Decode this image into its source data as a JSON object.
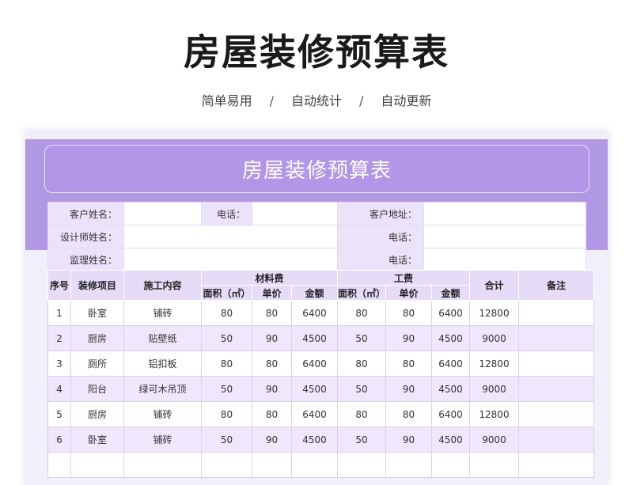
{
  "page": {
    "title": "房屋装修预算表",
    "tags": [
      "简单易用",
      "自动统计",
      "自动更新"
    ],
    "separator": "/"
  },
  "sheet": {
    "title": "房屋装修预算表",
    "info": {
      "customer_name_label": "客户姓名：",
      "phone_label_1": "电话：",
      "customer_address_label": "客户地址：",
      "designer_name_label": "设计师姓名：",
      "phone_label_2": "电话：",
      "supervisor_name_label": "监理姓名：",
      "phone_label_3": "电话："
    },
    "headers": {
      "index": "序号",
      "item": "装修项目",
      "content": "施工内容",
      "material_group": "材料费",
      "labor_group": "工费",
      "total": "合计",
      "remark": "备注",
      "area": "面积（㎡）",
      "unit_price": "单价",
      "amount": "金额"
    },
    "rows": [
      {
        "no": "1",
        "item": "卧室",
        "content": "铺砖",
        "m_area": "80",
        "m_price": "80",
        "m_amount": "6400",
        "l_area": "80",
        "l_price": "80",
        "l_amount": "6400",
        "total": "12800",
        "remark": ""
      },
      {
        "no": "2",
        "item": "厨房",
        "content": "贴壁纸",
        "m_area": "50",
        "m_price": "90",
        "m_amount": "4500",
        "l_area": "50",
        "l_price": "90",
        "l_amount": "4500",
        "total": "9000",
        "remark": ""
      },
      {
        "no": "3",
        "item": "厕所",
        "content": "铝扣板",
        "m_area": "80",
        "m_price": "80",
        "m_amount": "6400",
        "l_area": "80",
        "l_price": "80",
        "l_amount": "6400",
        "total": "12800",
        "remark": ""
      },
      {
        "no": "4",
        "item": "阳台",
        "content": "绿可木吊顶",
        "m_area": "50",
        "m_price": "90",
        "m_amount": "4500",
        "l_area": "50",
        "l_price": "90",
        "l_amount": "4500",
        "total": "9000",
        "remark": ""
      },
      {
        "no": "5",
        "item": "厨房",
        "content": "铺砖",
        "m_area": "80",
        "m_price": "80",
        "m_amount": "6400",
        "l_area": "80",
        "l_price": "80",
        "l_amount": "6400",
        "total": "12800",
        "remark": ""
      },
      {
        "no": "6",
        "item": "卧室",
        "content": "铺砖",
        "m_area": "50",
        "m_price": "90",
        "m_amount": "4500",
        "l_area": "50",
        "l_price": "90",
        "l_amount": "4500",
        "total": "9000",
        "remark": ""
      },
      {
        "no": "",
        "item": "",
        "content": "",
        "m_area": "",
        "m_price": "",
        "m_amount": "",
        "l_area": "",
        "l_price": "",
        "l_amount": "",
        "total": "",
        "remark": ""
      }
    ]
  },
  "colors": {
    "accent": "#b198e4",
    "header_bg": "#e6dcf8",
    "row_alt": "#efe7fb"
  }
}
